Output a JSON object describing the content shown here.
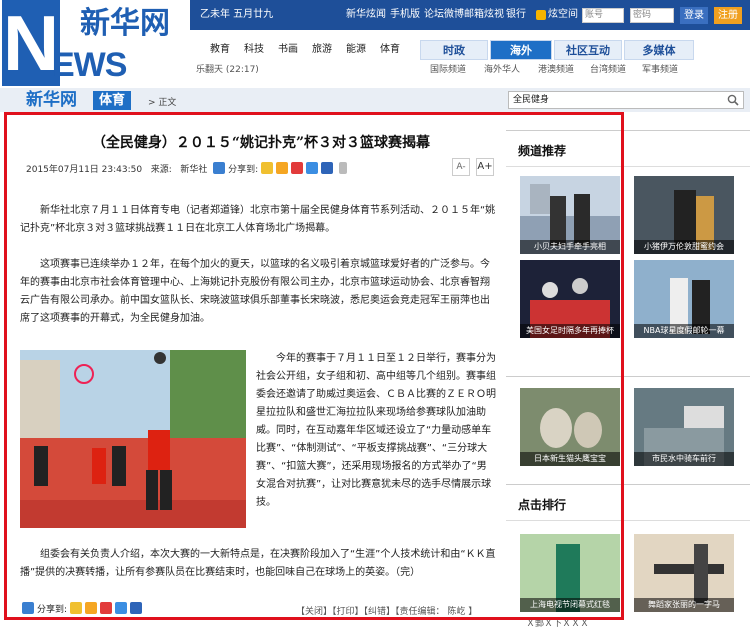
{
  "brand": {
    "logo_n": "N",
    "logo_ews": "EWS",
    "logo_cn": "新华网"
  },
  "topbar": {
    "date": "乙未年  五月廿九",
    "links": [
      "新华炫闻",
      "手机版",
      "论坛",
      "微博",
      "邮箱",
      "炫视",
      "银行"
    ],
    "login_link": "炫空间",
    "user_placeholder": "账号",
    "pass_placeholder": "密码",
    "login_btn": "登录",
    "register_btn": "注册"
  },
  "nav": {
    "items": [
      "教育",
      "科技",
      "书画",
      "旅游",
      "能源",
      "体育"
    ],
    "ticker": "乐翻天 (22:17)"
  },
  "tabs": [
    "时政",
    "海外",
    "社区互动",
    "多媒体"
  ],
  "subnav": [
    "国际频道",
    "海外华人",
    "港澳频道",
    "台湾频道",
    "军事频道"
  ],
  "section": {
    "site": "新华网",
    "channel": "体育",
    "crumb": "> 正文",
    "search_value": "全民健身"
  },
  "article": {
    "title": "（全民健身）２０１５“姚记扑克”杯３对３篮球赛揭幕",
    "date": "2015年07月11日 23:43:50",
    "source_label": "来源:",
    "source": "新华社",
    "share": "分享到:",
    "font_small": "A-",
    "font_large": "A+",
    "p1": "新华社北京７月１１日体育专电（记者郑道锋）北京市第十届全民健身体育节系列活动、２０１５年“姚记扑克”杯北京３对３篮球挑战赛１１日在北京工人体育场北广场揭幕。",
    "p2": "这项赛事已连续举办１２年，在每个加火的夏天，以篮球的名义吸引着京城篮球爱好者的广泛参与。今年的赛事由北京市社会体育管理中心、上海姚记扑克股份有限公司主办，北京市篮球运动协会、北京睿智翔云广告有限公司承办。前中国女篮队长、宋晓波篮球俱乐部董事长宋晓波，悉尼奥运会竞走冠军王丽萍也出席了这项赛事的开幕式，为全民健身加油。",
    "p3": "今年的赛事于７月１１日至１２日举行，赛事分为社会公开组，女子组和初、高中组等几个组别。赛事组委会还邀请了助威过奥运会、ＣＢＡ比赛的ＺＥＲＯ明星拉拉队和盛世汇海拉拉队来现场给参赛球队加油助威。同时，在互动嘉年华区域还设立了“力量动感单车比赛”、“体制测试”、“平板支撑挑战赛”、“三分球大赛”、“扣篮大赛”，还采用现场报名的方式举办了“男女混合对抗赛”，让对比赛意犹未尽的选手尽情展示球技。",
    "p4": "组委会有关负责人介绍，本次大赛的一大新特点是，在决赛阶段加入了“生涯”个人技术统计和由“ＫＫ直播”提供的决赛转播，让所有参赛队员在比赛结束时，也能回味自己在球场上的英姿。（完）",
    "footer_share": "分享到:",
    "footer_links": "【关闭】【打印】【纠错】【责任编辑：    陈屹 】"
  },
  "sidebar": {
    "section1": "频道推荐",
    "thumbs1": [
      "小贝夫妇手牵手亮相",
      "小猪伊万伦敦甜蜜约会",
      "美国女足时隔多年再捧杯",
      "NBA球星度假邮轮一幕"
    ],
    "thumbs2": [
      "日本新生猫头鹰宝宝",
      "市民水中骑车前行"
    ],
    "section2": "点击排行",
    "thumbs3": [
      "上海电视节闭幕式红毯",
      "舞蹈家张丽的一字马"
    ],
    "bottom_note": "Ｘ鄄Ｘ下ＸＸＸ"
  }
}
